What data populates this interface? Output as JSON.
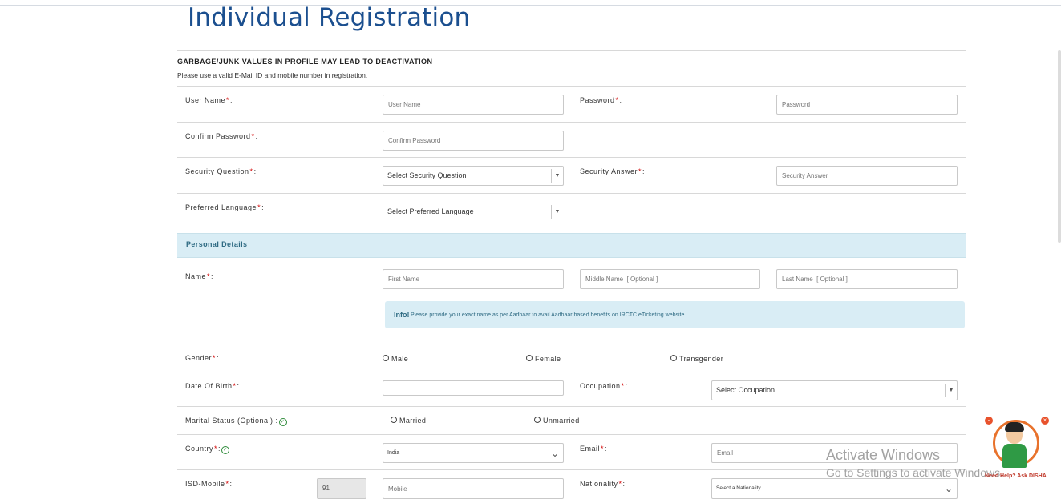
{
  "page": {
    "title": "Individual Registration",
    "warning": "GARBAGE/JUNK VALUES IN PROFILE MAY LEAD TO DEACTIVATION",
    "note": "Please use a valid E-Mail ID and mobile number in registration."
  },
  "account": {
    "username_label": "User Name",
    "username_suffix": ":",
    "username_placeholder": "User Name",
    "password_label": "Password",
    "password_suffix": ":",
    "password_placeholder": "Password",
    "confirm_label": "Confirm Password",
    "confirm_suffix": ":",
    "confirm_placeholder": "Confirm Password",
    "secq_label": "Security Question",
    "secq_suffix": ":",
    "secq_value": "Select Security Question",
    "seca_label": "Security Answer",
    "seca_suffix": ":",
    "seca_placeholder": "Security Answer",
    "lang_label": "Preferred Language",
    "lang_suffix": ":",
    "lang_value": "Select Preferred Language",
    "required_mark": "*"
  },
  "personal": {
    "section_title": "Personal Details",
    "name_label": "Name",
    "name_suffix": ":",
    "first_placeholder": "First Name",
    "middle_placeholder": "Middle Name  [ Optional ]",
    "last_placeholder": "Last Name  [ Optional ]",
    "info_strong": "Info!",
    "info_text": "Please provide your exact name as per Aadhaar to avail Aadhaar based benefits on IRCTC eTicketing website.",
    "gender_label": "Gender",
    "gender_suffix": ":",
    "gender_options": [
      "Male",
      "Female",
      "Transgender"
    ],
    "dob_label": "Date Of Birth",
    "dob_suffix": ":",
    "occupation_label": "Occupation",
    "occupation_suffix": ":",
    "occupation_value": "Select Occupation",
    "marital_label": "Marital Status (Optional) :",
    "marital_options": [
      "Married",
      "Unmarried"
    ],
    "country_label": "Country",
    "country_suffix": ":",
    "country_value": "India",
    "email_label": "Email",
    "email_suffix": ":",
    "email_placeholder": "Email",
    "isd_label": "ISD-Mobile",
    "isd_suffix": ":",
    "isd_value": "91",
    "mobile_placeholder": "Mobile",
    "nationality_label": "Nationality",
    "nationality_suffix": ":",
    "nationality_value": "Select a Nationality"
  },
  "overlay": {
    "activate_title": "Activate Windows",
    "activate_sub": "Go to Settings to activate Windows.",
    "disha_help": "Need Help? Ask DISHA"
  },
  "colors": {
    "title": "#1b4f8f",
    "required": "#d10000",
    "section_bg": "#d9edf5",
    "section_text": "#2f6b83",
    "check": "#2e8b3a"
  }
}
